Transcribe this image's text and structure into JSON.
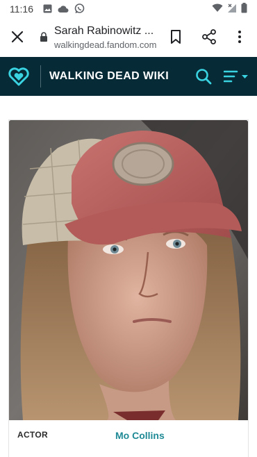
{
  "status_bar": {
    "time": "11:16",
    "left_icons": [
      "image-icon",
      "cloud-icon",
      "whatsapp-icon"
    ],
    "right_icons": [
      "wifi-icon",
      "signal-icon",
      "battery-icon"
    ]
  },
  "browser": {
    "page_title": "Sarah Rabinowitz ...",
    "url": "walkingdead.fandom.com",
    "icons": [
      "close-icon",
      "lock-icon",
      "bookmark-icon",
      "share-icon",
      "more-vert-icon"
    ]
  },
  "wiki_header": {
    "name": "WALKING DEAD WIKI",
    "accent_color": "#3ad3e1",
    "background_color": "#062a36"
  },
  "infobox": {
    "image_alt": "Portrait of a woman wearing a worn red trucker cap",
    "rows": [
      {
        "label": "ACTOR",
        "value": "Mo Collins"
      }
    ],
    "link_color": "#1f8a95"
  }
}
